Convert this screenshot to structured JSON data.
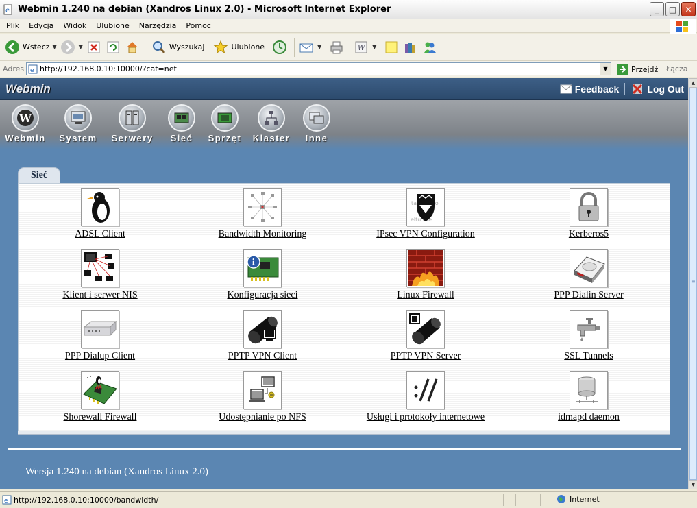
{
  "window": {
    "title": "Webmin 1.240 na debian (Xandros Linux 2.0) - Microsoft Internet Explorer",
    "minimize_label": "_",
    "maximize_label": "□",
    "close_label": "✕"
  },
  "menubar": {
    "items": [
      "Plik",
      "Edycja",
      "Widok",
      "Ulubione",
      "Narzędzia",
      "Pomoc"
    ]
  },
  "toolbar": {
    "back_label": "Wstecz",
    "search_label": "Wyszukaj",
    "favorites_label": "Ulubione"
  },
  "address": {
    "label": "Adres",
    "url": "http://192.168.0.10:10000/?cat=net",
    "go_label": "Przejdź",
    "links_label": "Łącza"
  },
  "webmin": {
    "logo": "Webmin",
    "feedback_label": "Feedback",
    "logout_label": "Log Out",
    "categories": [
      {
        "label": "Webmin",
        "icon": "webmin-icon"
      },
      {
        "label": "System",
        "icon": "monitor-icon"
      },
      {
        "label": "Serwery",
        "icon": "server-icon"
      },
      {
        "label": "Sieć",
        "icon": "network-card-icon"
      },
      {
        "label": "Sprzęt",
        "icon": "hardware-board-icon"
      },
      {
        "label": "Klaster",
        "icon": "cluster-icon"
      },
      {
        "label": "Inne",
        "icon": "windows-icon"
      }
    ],
    "active_tab": "Sieć",
    "modules": [
      {
        "label": "ADSL Client",
        "icon": "penguin-icon"
      },
      {
        "label": "Bandwidth Monitoring",
        "icon": "network-graph-icon"
      },
      {
        "label": "IPsec VPN Configuration",
        "icon": "shield-icon"
      },
      {
        "label": "Kerberos5",
        "icon": "padlock-icon"
      },
      {
        "label": "Klient i serwer NIS",
        "icon": "nis-network-icon"
      },
      {
        "label": "Konfiguracja sieci",
        "icon": "network-config-icon"
      },
      {
        "label": "Linux Firewall",
        "icon": "firewall-icon"
      },
      {
        "label": "PPP Dialin Server",
        "icon": "modem-drive-icon"
      },
      {
        "label": "PPP Dialup Client",
        "icon": "modem-icon"
      },
      {
        "label": "PPTP VPN Client",
        "icon": "tunnel-client-icon"
      },
      {
        "label": "PPTP VPN Server",
        "icon": "tunnel-server-icon"
      },
      {
        "label": "SSL Tunnels",
        "icon": "faucet-icon"
      },
      {
        "label": "Shorewall Firewall",
        "icon": "shorewall-icon"
      },
      {
        "label": "Udostępnianie po NFS",
        "icon": "nfs-share-icon"
      },
      {
        "label": "Usługi i protokoły internetowe",
        "icon": "protocol-icon"
      },
      {
        "label": "idmapd daemon",
        "icon": "database-icon"
      }
    ],
    "footer": "Wersja 1.240 na debian (Xandros Linux 2.0)"
  },
  "statusbar": {
    "text": "http://192.168.0.10:10000/bandwidth/",
    "zone_label": "Internet"
  },
  "colors": {
    "page_bg": "#5b86b2",
    "header_bg": "#2c4a6d",
    "panel_bg": "#ffffff"
  }
}
